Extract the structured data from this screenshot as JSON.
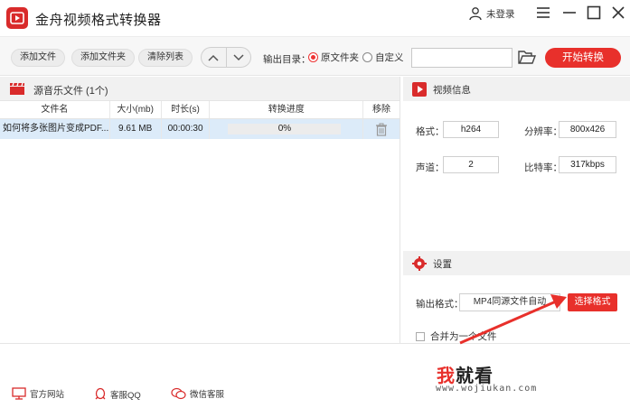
{
  "app": {
    "title": "金舟视频格式转换器",
    "login_label": "未登录"
  },
  "toolbar": {
    "add_file": "添加文件",
    "add_folder": "添加文件夹",
    "clear_list": "清除列表",
    "output_dir_label": "输出目录：",
    "radio_source": "原文件夹",
    "radio_custom": "自定义",
    "output_path": "",
    "start_button": "开始转换"
  },
  "file_list": {
    "title": "源音乐文件 (1个)",
    "columns": [
      "文件名",
      "大小(mb)",
      "时长(s)",
      "转换进度",
      "移除"
    ],
    "rows": [
      {
        "name": "如何将多张图片变成PDF...",
        "size": "9.61 MB",
        "duration": "00:00:30",
        "progress_text": "0%",
        "progress": 0
      }
    ]
  },
  "video_info": {
    "title": "视频信息",
    "format_label": "格式：",
    "format_value": "h264",
    "resolution_label": "分辨率：",
    "resolution_value": "800x426",
    "channel_label": "声道：",
    "channel_value": "2",
    "bitrate_label": "比特率：",
    "bitrate_value": "317kbps"
  },
  "settings": {
    "title": "设置",
    "output_format_label": "输出格式：",
    "output_format_value": "MP4同源文件自动",
    "choose_format_button": "选择格式",
    "merge_label": "合并为一个文件",
    "merge_checked": false
  },
  "footer": {
    "website": "官方网站",
    "qq": "客服QQ",
    "wechat": "微信客服"
  },
  "watermark": {
    "brand_char1": "我",
    "brand_rest": "就看",
    "url": "www.wojiukan.com"
  },
  "colors": {
    "accent": "#e8302b",
    "selected_row": "#dcebf9",
    "header_bg": "#f1f1f1"
  }
}
